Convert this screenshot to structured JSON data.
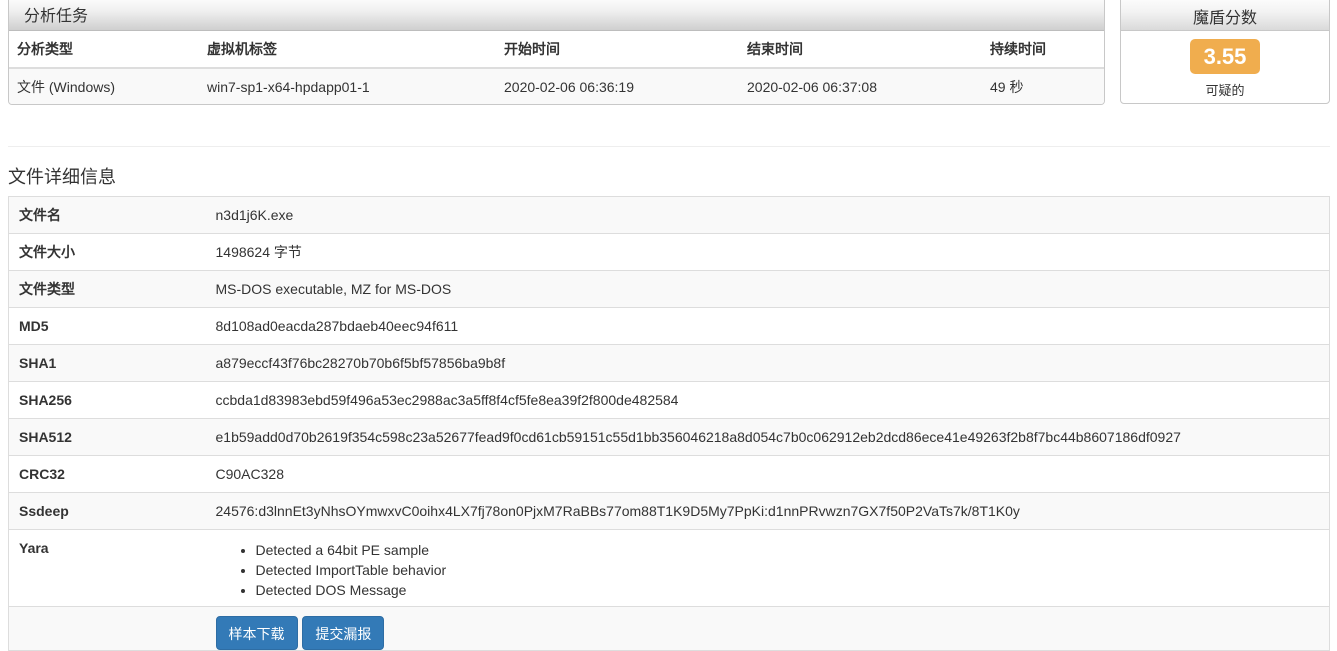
{
  "task_panel": {
    "title": "分析任务",
    "headers": [
      "分析类型",
      "虚拟机标签",
      "开始时间",
      "结束时间",
      "持续时间"
    ],
    "row": [
      "文件 (Windows)",
      "win7-sp1-x64-hpdapp01-1",
      "2020-02-06 06:36:19",
      "2020-02-06 06:37:08",
      "49 秒"
    ]
  },
  "score_panel": {
    "title": "魔盾分数",
    "score": "3.55",
    "label": "可疑的",
    "badge_color": "#f0ad4e"
  },
  "file_details": {
    "title": "文件详细信息",
    "rows": [
      {
        "key": "文件名",
        "value": "n3d1j6K.exe"
      },
      {
        "key": "文件大小",
        "value": "1498624 字节"
      },
      {
        "key": "文件类型",
        "value": "MS-DOS executable, MZ for MS-DOS"
      },
      {
        "key": "MD5",
        "value": "8d108ad0eacda287bdaeb40eec94f611"
      },
      {
        "key": "SHA1",
        "value": "a879eccf43f76bc28270b70b6f5bf57856ba9b8f"
      },
      {
        "key": "SHA256",
        "value": "ccbda1d83983ebd59f496a53ec2988ac3a5ff8f4cf5fe8ea39f2f800de482584"
      },
      {
        "key": "SHA512",
        "value": "e1b59add0d70b2619f354c598c23a52677fead9f0cd61cb59151c55d1bb356046218a8d054c7b0c062912eb2dcd86ece41e49263f2b8f7bc44b8607186df0927"
      },
      {
        "key": "CRC32",
        "value": "C90AC328"
      },
      {
        "key": "Ssdeep",
        "value": "24576:d3lnnEt3yNhsOYmwxvC0oihx4LX7fj78on0PjxM7RaBBs77om88T1K9D5My7PpKi:d1nnPRvwzn7GX7f50P2VaTs7k/8T1K0y"
      }
    ],
    "yara": {
      "key": "Yara",
      "items": [
        "Detected a 64bit PE sample",
        "Detected ImportTable behavior",
        "Detected DOS Message"
      ]
    },
    "buttons": {
      "download": "样本下载",
      "report": "提交漏报"
    }
  }
}
